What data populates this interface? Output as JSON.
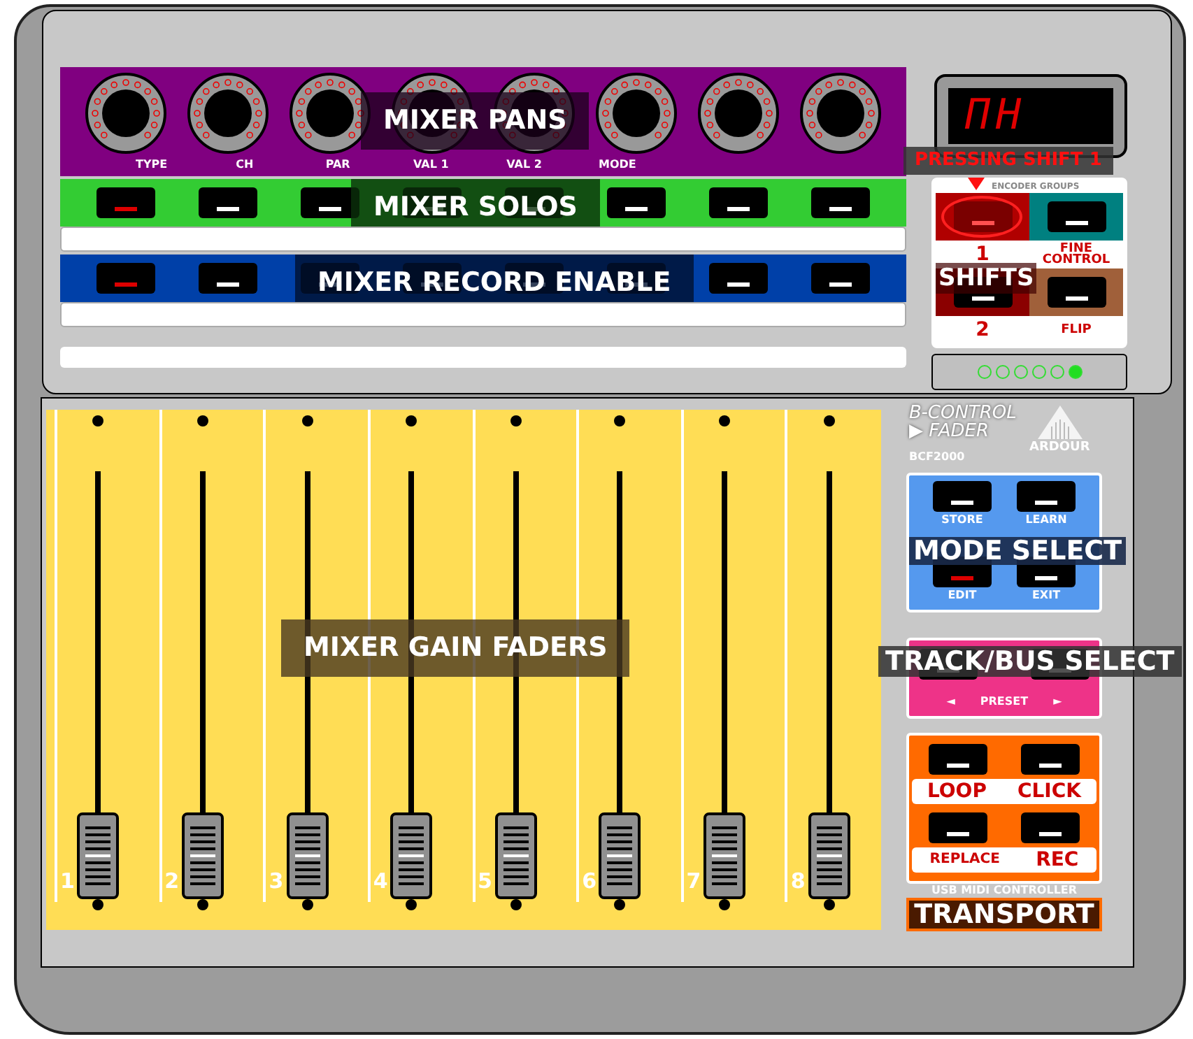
{
  "encoders": {
    "overlay": "MIXER PANS",
    "labels": [
      "TYPE",
      "CH",
      "PAR",
      "VAL 1",
      "VAL 2",
      "MODE"
    ]
  },
  "solos": {
    "overlay": "MIXER SOLOS",
    "buttons": [
      {
        "lit": true
      },
      {
        "lit": false
      },
      {
        "lit": false
      },
      {
        "lit": false
      },
      {
        "lit": false
      },
      {
        "lit": false
      },
      {
        "lit": false
      },
      {
        "lit": false
      }
    ]
  },
  "record_enable": {
    "overlay": "MIXER RECORD ENABLE",
    "buttons": [
      {
        "lit": true
      },
      {
        "lit": false
      },
      {
        "lit": false
      },
      {
        "lit": false
      },
      {
        "lit": false
      },
      {
        "lit": false
      },
      {
        "lit": false
      },
      {
        "lit": false
      }
    ]
  },
  "display": {
    "readout": "ΠH"
  },
  "encoder_groups": {
    "caption": "ENCODER GROUPS",
    "callout": "PRESSING SHIFT 1",
    "shift_overlay": "SHIFTS",
    "buttons": [
      {
        "label": "1",
        "color": "#b00000",
        "pressed": true
      },
      {
        "label": "FINE CONTROL",
        "color": "#008080",
        "pressed": false
      },
      {
        "label": "2",
        "color": "#8b0000",
        "pressed": false
      },
      {
        "label": "FLIP",
        "color": "#a0603a",
        "pressed": false
      }
    ]
  },
  "group_leds": [
    {
      "on": false
    },
    {
      "on": false
    },
    {
      "on": false
    },
    {
      "on": false
    },
    {
      "on": false
    },
    {
      "on": true
    }
  ],
  "faders": {
    "overlay": "MIXER GAIN FADERS",
    "channels": [
      {
        "number": "1"
      },
      {
        "number": "2"
      },
      {
        "number": "3"
      },
      {
        "number": "4"
      },
      {
        "number": "5"
      },
      {
        "number": "6"
      },
      {
        "number": "7"
      },
      {
        "number": "8"
      }
    ]
  },
  "brand": {
    "line1": "B-CONTROL",
    "line2": "▶ FADER",
    "model": "BCF2000",
    "logo_text": "ARDOUR"
  },
  "mode_select": {
    "overlay": "MODE SELECT",
    "buttons": [
      {
        "label": "STORE",
        "lit": false
      },
      {
        "label": "LEARN",
        "lit": false
      },
      {
        "label": "EDIT",
        "lit": true
      },
      {
        "label": "EXIT",
        "lit": false
      }
    ]
  },
  "track_select": {
    "overlay": "TRACK/BUS SELECT",
    "caption_left": "◄",
    "caption": "PRESET",
    "caption_right": "►",
    "buttons": [
      {
        "lit": false
      },
      {
        "lit": false
      }
    ]
  },
  "transport": {
    "overlay": "TRANSPORT",
    "caption": "USB MIDI CONTROLLER",
    "buttons": [
      {
        "label": "LOOP",
        "lit": false
      },
      {
        "label": "CLICK",
        "lit": false
      },
      {
        "label": "REPLACE",
        "lit": false
      },
      {
        "label": "REC",
        "lit": false
      }
    ]
  }
}
